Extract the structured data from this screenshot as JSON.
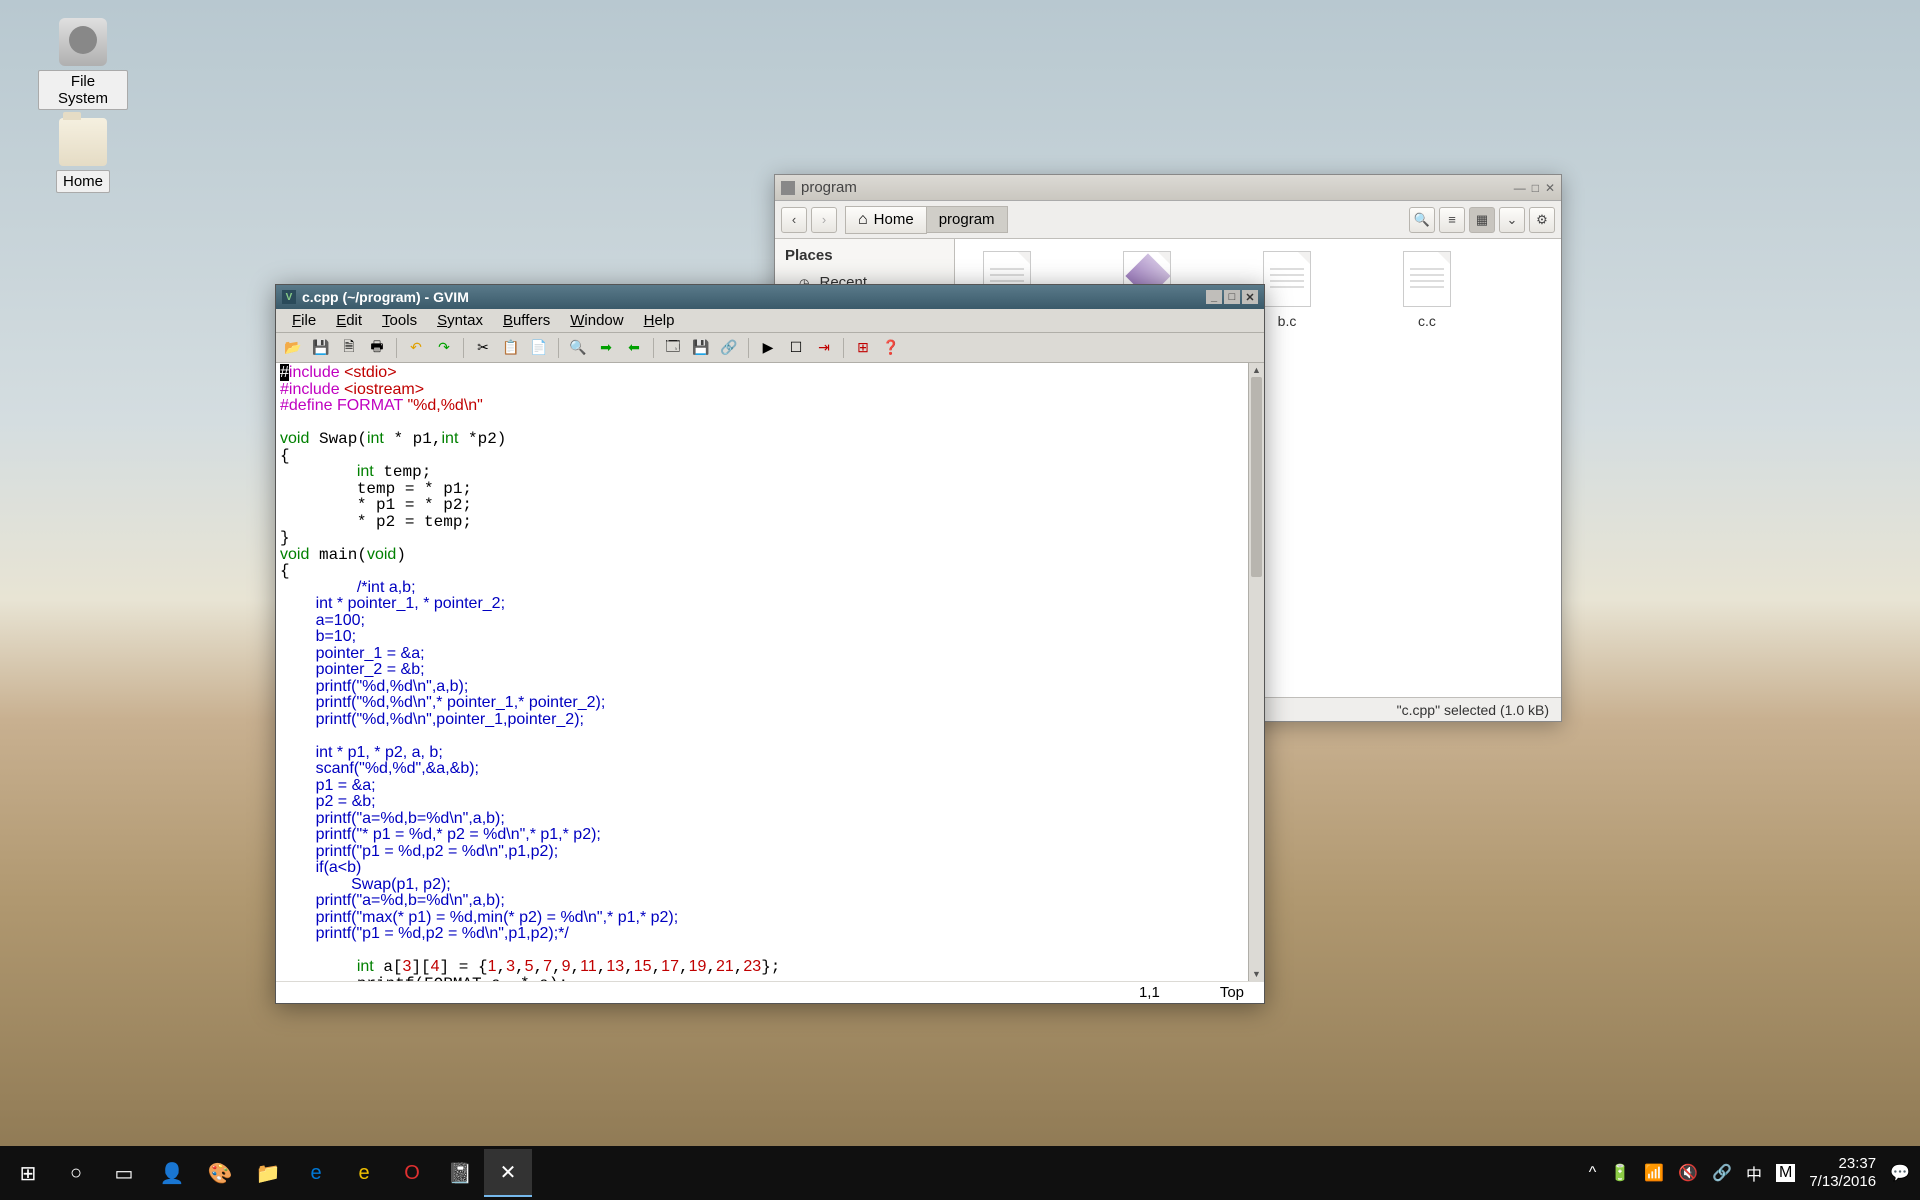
{
  "desktop": {
    "icons": [
      {
        "label": "File System"
      },
      {
        "label": "Home"
      }
    ]
  },
  "file_manager": {
    "title": "program",
    "breadcrumb": {
      "home": "Home",
      "current": "program"
    },
    "sidebar": {
      "heading": "Places",
      "items": [
        "Recent"
      ]
    },
    "files": [
      {
        "name": ""
      },
      {
        "name": "",
        "selected": true
      },
      {
        "name": "b.c"
      },
      {
        "name": "c.c"
      }
    ],
    "status": "\"c.cpp\" selected  (1.0 kB)"
  },
  "gvim": {
    "title": "c.cpp (~/program) - GVIM",
    "menus": [
      "File",
      "Edit",
      "Tools",
      "Syntax",
      "Buffers",
      "Window",
      "Help"
    ],
    "status": {
      "pos": "1,1",
      "scroll": "Top"
    }
  },
  "taskbar": {
    "time": "23:37",
    "date": "7/13/2016",
    "ime1": "中",
    "ime2": "M"
  }
}
